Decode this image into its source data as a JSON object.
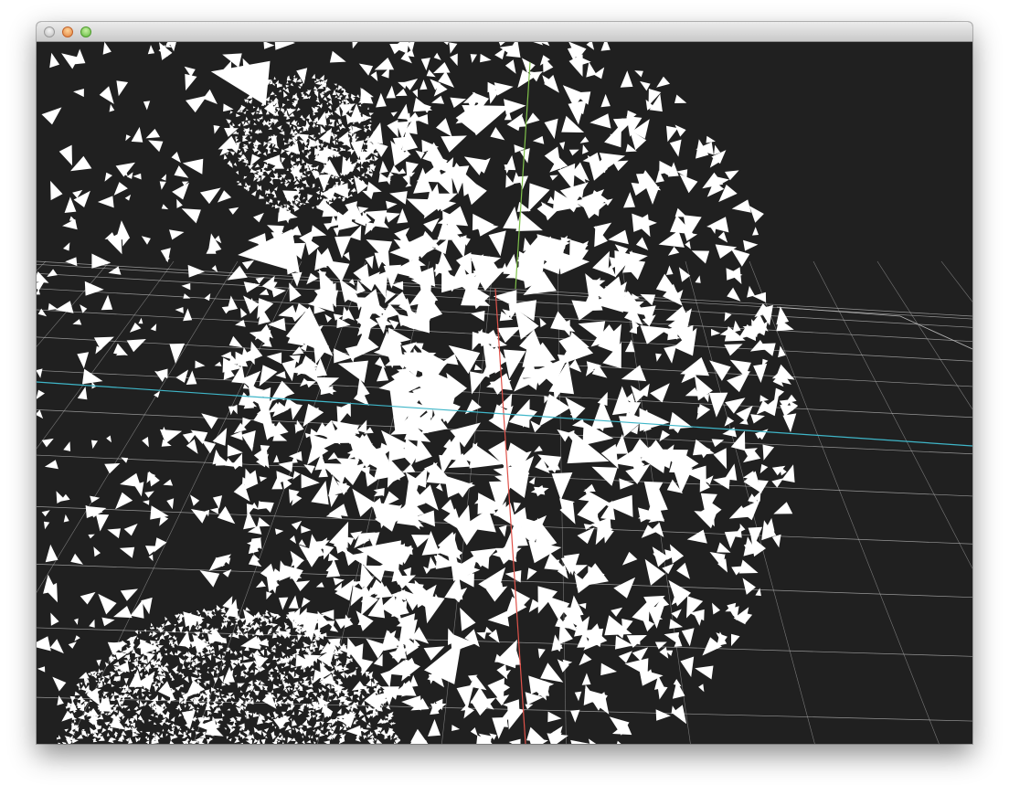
{
  "window": {
    "title": "",
    "buttons": {
      "close": "close-button",
      "minimize": "minimize-button",
      "zoom": "zoom-button"
    }
  },
  "viewport": {
    "background_color": "#202020",
    "grid_color": "#b4b4b4",
    "mesh_color": "#ffffff",
    "axes": {
      "x_color": "#e0524a",
      "y_color": "#7fc24a",
      "z_color": "#3fb6c8"
    },
    "objects": [
      "large-sphere",
      "small-sphere-top",
      "small-sphere-bottom",
      "ground-grid"
    ]
  }
}
